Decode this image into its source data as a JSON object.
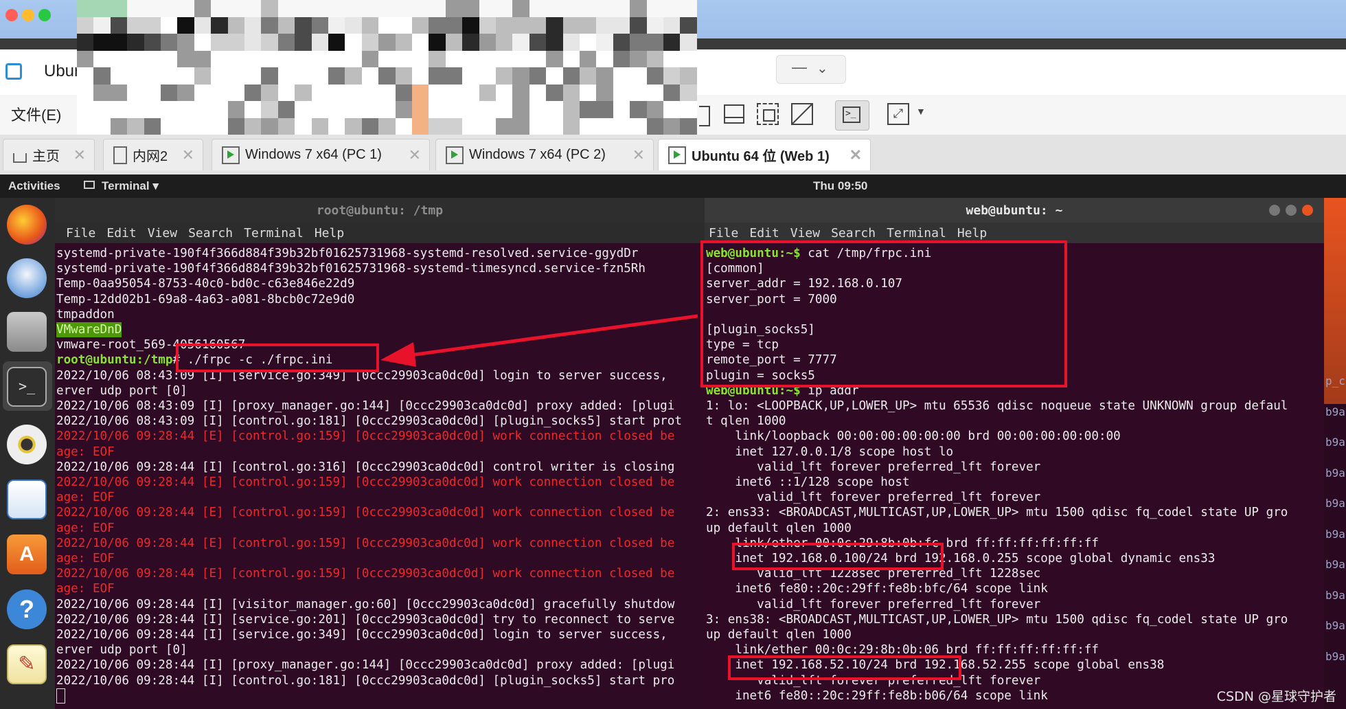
{
  "colors": {
    "accent_red": "#e8122a",
    "terminal_bg": "#2f0a24",
    "prompt_green": "#8ae234",
    "error_red": "#ef2929"
  },
  "vmware": {
    "app_title": "Ubur",
    "menu_file": "文件(E)"
  },
  "tabs": [
    {
      "label": "主页",
      "icon": "home-icon"
    },
    {
      "label": "内网2",
      "icon": "page-icon"
    },
    {
      "label": "Windows 7 x64 (PC 1)",
      "icon": "vm-icon"
    },
    {
      "label": "Windows 7 x64 (PC 2)",
      "icon": "vm-icon"
    },
    {
      "label": "Ubuntu 64 位 (Web 1)",
      "icon": "vm-icon"
    }
  ],
  "gnome": {
    "activities": "Activities",
    "app": "Terminal ▾",
    "clock": "Thu 09:50"
  },
  "left_term": {
    "title": "root@ubuntu: /tmp",
    "menu": [
      "File",
      "Edit",
      "View",
      "Search",
      "Terminal",
      "Help"
    ],
    "lines": [
      "systemd-private-190f4f366d884f39b32bf01625731968-systemd-resolved.service-ggydDr",
      "systemd-private-190f4f366d884f39b32bf01625731968-systemd-timesyncd.service-fzn5Rh",
      "Temp-0aa95054-8753-40c0-bd0c-c63e846e22d9",
      "Temp-12dd02b1-69a8-4a63-a081-8bcb0c72e9d0",
      "tmpaddon",
      "VMwareDnD",
      "vmware-root_569-4056160567",
      "# ./frpc -c ./frpc.ini",
      "2022/10/06 08:43:09 [I] [service.go:349] [0ccc29903ca0dc0d] login to server success,",
      "erver udp port [0]",
      "2022/10/06 08:43:09 [I] [proxy_manager.go:144] [0ccc29903ca0dc0d] proxy added: [plugi",
      "2022/10/06 08:43:09 [I] [control.go:181] [0ccc29903ca0dc0d] [plugin_socks5] start prot",
      "2022/10/06 09:28:44 [E] [control.go:159] [0ccc29903ca0dc0d] work connection closed be",
      "age: EOF",
      "2022/10/06 09:28:44 [I] [control.go:316] [0ccc29903ca0dc0d] control writer is closing",
      "2022/10/06 09:28:44 [E] [control.go:159] [0ccc29903ca0dc0d] work connection closed be",
      "age: EOF",
      "2022/10/06 09:28:44 [E] [control.go:159] [0ccc29903ca0dc0d] work connection closed be",
      "age: EOF",
      "2022/10/06 09:28:44 [E] [control.go:159] [0ccc29903ca0dc0d] work connection closed be",
      "age: EOF",
      "2022/10/06 09:28:44 [E] [control.go:159] [0ccc29903ca0dc0d] work connection closed be",
      "age: EOF",
      "2022/10/06 09:28:44 [I] [visitor_manager.go:60] [0ccc29903ca0dc0d] gracefully shutdow",
      "2022/10/06 09:28:44 [I] [service.go:201] [0ccc29903ca0dc0d] try to reconnect to serve",
      "2022/10/06 09:28:44 [I] [service.go:349] [0ccc29903ca0dc0d] login to server success,",
      "erver udp port [0]",
      "2022/10/06 09:28:44 [I] [proxy_manager.go:144] [0ccc29903ca0dc0d] proxy added: [plugi",
      "2022/10/06 09:28:44 [I] [control.go:181] [0ccc29903ca0dc0d] [plugin_socks5] start pro"
    ],
    "prompt": "root@ubuntu:/tmp"
  },
  "right_term": {
    "title": "web@ubuntu: ~",
    "menu": [
      "File",
      "Edit",
      "View",
      "Search",
      "Terminal",
      "Help"
    ],
    "prompt": "web@ubuntu:~$",
    "lines": [
      " cat /tmp/frpc.ini",
      "[common]",
      "server_addr = 192.168.0.107",
      "server_port = 7000",
      "",
      "[plugin_socks5]",
      "type = tcp",
      "remote_port = 7777",
      "plugin = socks5",
      " ip addr",
      "1: lo: <LOOPBACK,UP,LOWER_UP> mtu 65536 qdisc noqueue state UNKNOWN group defaul",
      "t qlen 1000",
      "    link/loopback 00:00:00:00:00:00 brd 00:00:00:00:00:00",
      "    inet 127.0.0.1/8 scope host lo",
      "       valid_lft forever preferred_lft forever",
      "    inet6 ::1/128 scope host",
      "       valid_lft forever preferred_lft forever",
      "2: ens33: <BROADCAST,MULTICAST,UP,LOWER_UP> mtu 1500 qdisc fq_codel state UP gro",
      "up default qlen 1000",
      "    link/ether 00:0c:29:8b:0b:fc brd ff:ff:ff:ff:ff:ff",
      "    inet 192.168.0.100/24 brd 192.168.0.255 scope global dynamic ens33",
      "       valid_lft 1228sec preferred_lft 1228sec",
      "    inet6 fe80::20c:29ff:fe8b:bfc/64 scope link",
      "       valid_lft forever preferred_lft forever",
      "3: ens38: <BROADCAST,MULTICAST,UP,LOWER_UP> mtu 1500 qdisc fq_codel state UP gro",
      "up default qlen 1000",
      "    link/ether 00:0c:29:8b:0b:06 brd ff:ff:ff:ff:ff:ff",
      "    inet 192.168.52.10/24 brd 192.168.52.255 scope global ens38",
      "       valid_lft forever preferred_lft forever",
      "    inet6 fe80::20c:29ff:fe8b:b06/64 scope link"
    ]
  },
  "edge_fragments": [
    "p_c",
    "b9a",
    "b9a",
    "b9a",
    "b9a",
    "b9a",
    "b9a",
    "b9a",
    "b9a",
    "b9a"
  ],
  "watermark": "CSDN @星球守护者"
}
